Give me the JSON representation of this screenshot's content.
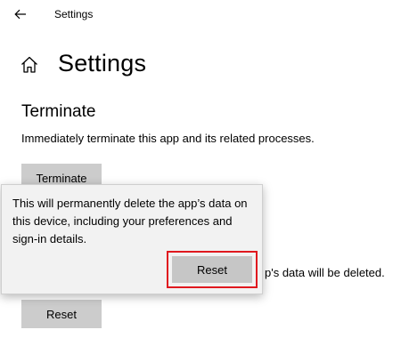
{
  "window": {
    "title": "Settings",
    "back_icon": "arrow-left-icon"
  },
  "header": {
    "home_icon": "home-icon",
    "title": "Settings"
  },
  "terminate_section": {
    "heading": "Terminate",
    "description": "Immediately terminate this app and its related processes.",
    "button_label": "Terminate"
  },
  "reset_section": {
    "partial_description": "p's data will be deleted.",
    "button_label": "Reset"
  },
  "flyout": {
    "message": "This will permanently delete the app’s data on this device, including your preferences and sign-in details.",
    "button_label": "Reset",
    "highlight_color": "#e0191f"
  }
}
